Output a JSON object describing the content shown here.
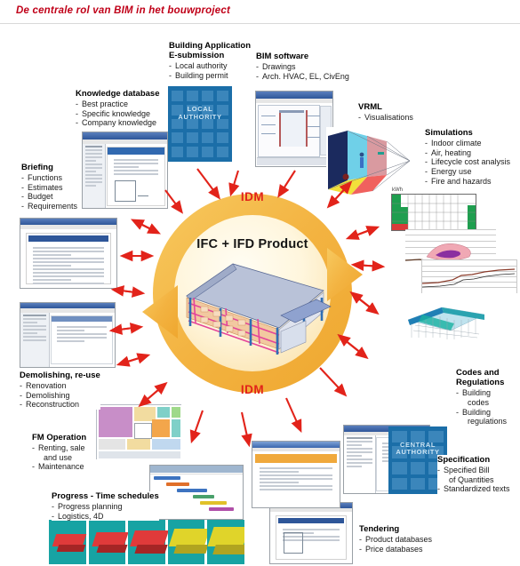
{
  "page": {
    "title": "De centrale rol van BIM in het bouwproject",
    "title_color": "#c00018"
  },
  "center": {
    "core_label": "IFC + IFD Product",
    "ring_label_top": "IDM",
    "ring_label_bottom": "IDM",
    "ring_color": "#f5b942",
    "model_alt": "3d-bim-building-model"
  },
  "nodes": [
    {
      "id": "building-application",
      "heading": "Building Application",
      "heading2": "E-submission",
      "items": [
        "Local authority",
        "Building permit"
      ],
      "image": "local-authority-building"
    },
    {
      "id": "bim-software",
      "heading": "BIM software",
      "items": [
        "Drawings",
        "Arch. HVAC, EL, CivEng"
      ],
      "image": "cad-drawing-window"
    },
    {
      "id": "knowledge-database",
      "heading": "Knowledge database",
      "items": [
        "Best practice",
        "Specific knowledge",
        "Company knowledge"
      ],
      "image": "knowledge-document-window"
    },
    {
      "id": "vrml",
      "heading": "VRML",
      "items": [
        "Visualisations"
      ],
      "image": "vrml-visualisation"
    },
    {
      "id": "simulations",
      "heading": "Simulations",
      "items": [
        "Indoor climate",
        "Air, heating",
        "Lifecycle cost analysis",
        "Energy use",
        "Fire and hazards"
      ],
      "image": "simulation-charts"
    },
    {
      "id": "briefing",
      "heading": "Briefing",
      "items": [
        "Functions",
        "Estimates",
        "Budget",
        "Requirements"
      ],
      "image": "briefing-document-window"
    },
    {
      "id": "demolishing-reuse",
      "heading": "Demolishing, re-use",
      "items": [
        "Renovation",
        "Demolishing",
        "Reconstruction"
      ],
      "image": "demolition-software-window"
    },
    {
      "id": "fm-operation",
      "heading": "FM Operation",
      "items": [
        "Renting, sale",
        "and use",
        "Maintenance"
      ],
      "image": "facility-floorplan"
    },
    {
      "id": "progress-time-schedules",
      "heading": "Progress - Time schedules",
      "items": [
        "Progress planning",
        "Logistics, 4D"
      ],
      "image": "gantt-chart"
    },
    {
      "id": "tendering",
      "heading": "Tendering",
      "items": [
        "Product databases",
        "Price databases"
      ],
      "image": "tendering-window"
    },
    {
      "id": "specification",
      "heading": "Specification",
      "items": [
        "Specified Bill",
        "of Quantities",
        "Standardized texts"
      ],
      "image": "specification-window"
    },
    {
      "id": "codes-and-regulations",
      "heading": "Codes and",
      "heading2": "Regulations",
      "items": [
        "Building",
        "codes",
        "Building",
        "regulations"
      ],
      "image": "central-authority-building"
    },
    {
      "id": "structural-analysis",
      "heading": "",
      "items": [],
      "image": "structural-mesh-model"
    }
  ],
  "images": {
    "local_authority_text": "LOCAL\nAUTHORITY",
    "local_authority_line1": "LOCAL",
    "local_authority_line2": "AUTHORITY",
    "central_authority_line1": "CENTRAL",
    "central_authority_line2": "AUTHORITY"
  },
  "colors": {
    "title": "#c00018",
    "arrow": "#e2231a",
    "ring": "#f5b942",
    "ring_inner": "#fff7e0",
    "authority_blue": "#1b6ea8",
    "authority_cell": "#3b86bb"
  }
}
